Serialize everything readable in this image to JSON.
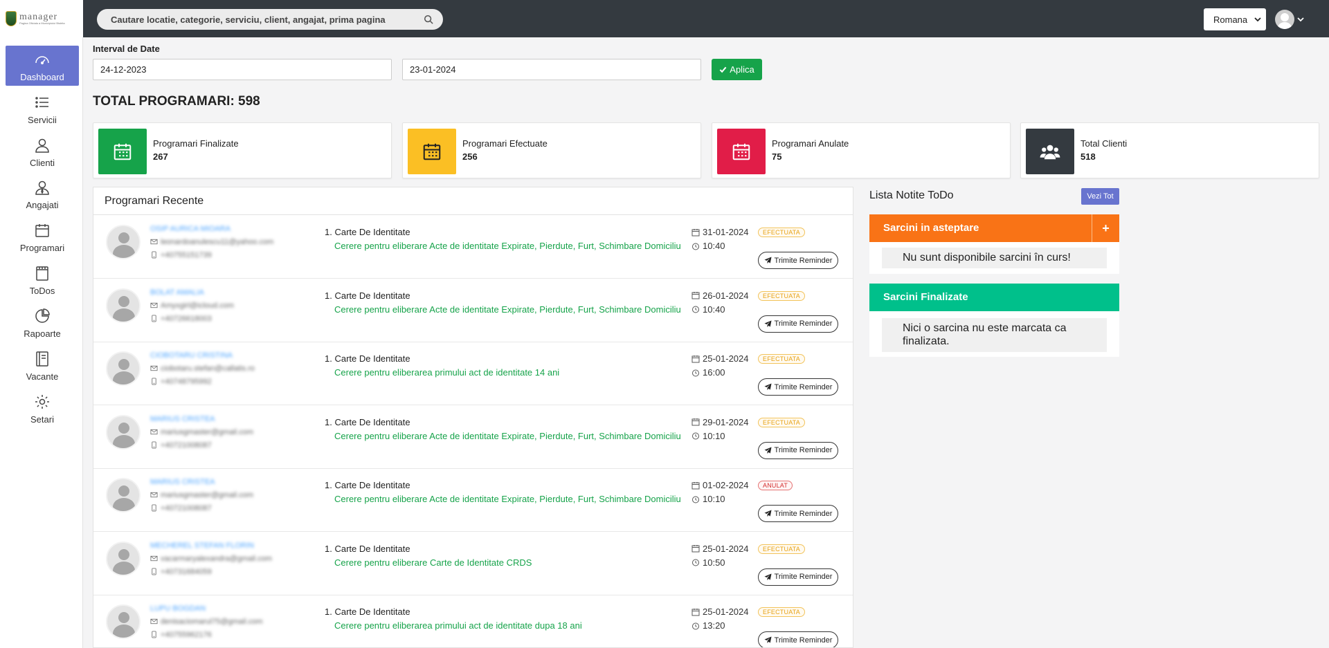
{
  "app": {
    "logo_text": "manager",
    "logo_subtitle": "Pagina Oficiala a Municipiului Bistrita"
  },
  "sidebar": {
    "items": [
      {
        "label": "Dashboard",
        "icon": "gauge-icon",
        "active": true
      },
      {
        "label": "Servicii",
        "icon": "list-icon"
      },
      {
        "label": "Clienti",
        "icon": "user-icon"
      },
      {
        "label": "Angajati",
        "icon": "user-tie-icon"
      },
      {
        "label": "Programari",
        "icon": "calendar-icon"
      },
      {
        "label": "ToDos",
        "icon": "notepad-icon"
      },
      {
        "label": "Rapoarte",
        "icon": "pie-chart-icon"
      },
      {
        "label": "Vacante",
        "icon": "book-icon"
      },
      {
        "label": "Setari",
        "icon": "gear-icon"
      }
    ]
  },
  "topbar": {
    "search_placeholder": "Cautare locatie, categorie, serviciu, client, angajat, prima pagina",
    "language": "Romana"
  },
  "filter": {
    "label": "Interval de Date",
    "start_date": "24-12-2023",
    "end_date": "23-01-2024",
    "apply_label": "Aplica"
  },
  "total_label": "TOTAL PROGRAMARI: 598",
  "stats": [
    {
      "label": "Programari Finalizate",
      "value": "267",
      "color": "#16a34a",
      "icon": "calendar-icon"
    },
    {
      "label": "Programari Efectuate",
      "value": "256",
      "color": "#fbbf24",
      "icon": "calendar-icon"
    },
    {
      "label": "Programari Anulate",
      "value": "75",
      "color": "#e11d48",
      "icon": "calendar-icon"
    },
    {
      "label": "Total Clienti",
      "value": "518",
      "color": "#343a40",
      "icon": "users-icon"
    }
  ],
  "recent": {
    "title": "Programari Recente",
    "reminder_label": "Trimite Reminder",
    "rows": [
      {
        "name": "OSIP AURICA MIOARA",
        "email": "leonardoanulescu11@yahoo.com",
        "phone": "+40755151739",
        "service": "1. Carte De Identitate",
        "request": "Cerere pentru eliberare Acte de identitate Expirate, Pierdute, Furt, Schimbare Domiciliu",
        "date": "31-01-2024",
        "time": "10:40",
        "status": "EFECTUATA",
        "status_type": "ok"
      },
      {
        "name": "BOLAT AMALIA",
        "email": "Amyxgirl@icloud.com",
        "phone": "+40726618003",
        "service": "1. Carte De Identitate",
        "request": "Cerere pentru eliberare Acte de identitate Expirate, Pierdute, Furt, Schimbare Domiciliu",
        "date": "26-01-2024",
        "time": "10:40",
        "status": "EFECTUATA",
        "status_type": "ok"
      },
      {
        "name": "CIOBOTARU CRISTINA",
        "email": "ciobotaru.stefan@callatis.ro",
        "phone": "+40748795992",
        "service": "1. Carte De Identitate",
        "request": "Cerere pentru eliberarea primului act de identitate 14 ani",
        "date": "25-01-2024",
        "time": "16:00",
        "status": "EFECTUATA",
        "status_type": "ok"
      },
      {
        "name": "MARIUS CRISTEA",
        "email": "mariusgmaster@gmail.com",
        "phone": "+40721008087",
        "service": "1. Carte De Identitate",
        "request": "Cerere pentru eliberare Acte de identitate Expirate, Pierdute, Furt, Schimbare Domiciliu",
        "date": "29-01-2024",
        "time": "10:10",
        "status": "EFECTUATA",
        "status_type": "ok"
      },
      {
        "name": "MARIUS CRISTEA",
        "email": "mariusgmaster@gmail.com",
        "phone": "+40721008087",
        "service": "1. Carte De Identitate",
        "request": "Cerere pentru eliberare Acte de identitate Expirate, Pierdute, Furt, Schimbare Domiciliu",
        "date": "01-02-2024",
        "time": "10:10",
        "status": "ANULAT",
        "status_type": "bad"
      },
      {
        "name": "MECHEREL STEFAN FLORIN",
        "email": "vacarmaryalexandra@gmail.com",
        "phone": "+40731684059",
        "service": "1. Carte De Identitate",
        "request": "Cerere pentru eliberare Carte de Identitate CRDS",
        "date": "25-01-2024",
        "time": "10:50",
        "status": "EFECTUATA",
        "status_type": "ok"
      },
      {
        "name": "LUPU BOGDAN",
        "email": "denisaciomarul75@gmail.com",
        "phone": "+40755962176",
        "service": "1. Carte De Identitate",
        "request": "Cerere pentru eliberarea primului act de identitate dupa 18 ani",
        "date": "25-01-2024",
        "time": "13:20",
        "status": "EFECTUATA",
        "status_type": "ok"
      }
    ]
  },
  "todo": {
    "title": "Lista Notite ToDo",
    "view_all": "Vezi Tot",
    "pending_title": "Sarcini in asteptare",
    "add_symbol": "+",
    "pending_empty": "Nu sunt disponibile sarcini în curs!",
    "done_title": "Sarcini Finalizate",
    "done_empty": "Nici o sarcina nu este marcata ca finalizata."
  }
}
